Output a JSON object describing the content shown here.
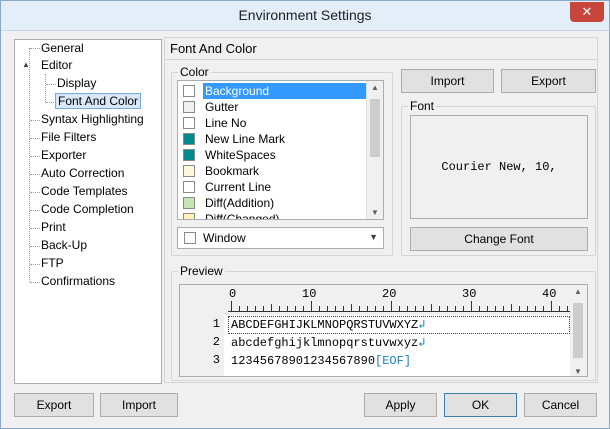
{
  "window": {
    "title": "Environment Settings",
    "close_glyph": "✕"
  },
  "tree": {
    "items": [
      {
        "label": "General"
      },
      {
        "label": "Editor",
        "expander": "▲"
      },
      {
        "label": "Display"
      },
      {
        "label": "Font And Color",
        "selected": true
      },
      {
        "label": "Syntax Highlighting"
      },
      {
        "label": "File Filters"
      },
      {
        "label": "Exporter"
      },
      {
        "label": "Auto Correction"
      },
      {
        "label": "Code Templates"
      },
      {
        "label": "Code Completion"
      },
      {
        "label": "Print"
      },
      {
        "label": "Back-Up"
      },
      {
        "label": "FTP"
      },
      {
        "label": "Confirmations"
      }
    ]
  },
  "panel": {
    "title": "Font And Color",
    "color_group": "Color",
    "color_items": [
      {
        "label": "Background",
        "color": "#ffffff",
        "selected": true
      },
      {
        "label": "Gutter",
        "color": "#f0f0f0"
      },
      {
        "label": "Line No",
        "color": "#ffffff"
      },
      {
        "label": "New Line Mark",
        "color": "#008b8b"
      },
      {
        "label": "WhiteSpaces",
        "color": "#008b8b"
      },
      {
        "label": "Bookmark",
        "color": "#fff8dc"
      },
      {
        "label": "Current Line",
        "color": "#ffffff"
      },
      {
        "label": "Diff(Addition)",
        "color": "#c8e6b4"
      },
      {
        "label": "Diff(Changed)",
        "color": "#fff5b4"
      }
    ],
    "scope_select": {
      "value": "Window",
      "color": "#ffffff"
    },
    "import_label": "Import",
    "export_label": "Export",
    "font_group": "Font",
    "font_sample": "Courier New, 10,",
    "change_font_label": "Change Font",
    "preview_group": "Preview",
    "ruler_numbers": [
      "0",
      "10",
      "20",
      "30",
      "40"
    ],
    "line_numbers": [
      "1",
      "2",
      "3"
    ],
    "code_lines": [
      {
        "text": "ABCDEFGHIJKLMNOPQRSTUVWXYZ",
        "mark": "↲"
      },
      {
        "text": "abcdefghijklmnopqrstuvwxyz",
        "mark": "↲"
      },
      {
        "text": "12345678901234567890",
        "mark": "[EOF]"
      }
    ]
  },
  "footer": {
    "export_label": "Export",
    "import_label": "Import",
    "apply_label": "Apply",
    "ok_label": "OK",
    "cancel_label": "Cancel"
  }
}
